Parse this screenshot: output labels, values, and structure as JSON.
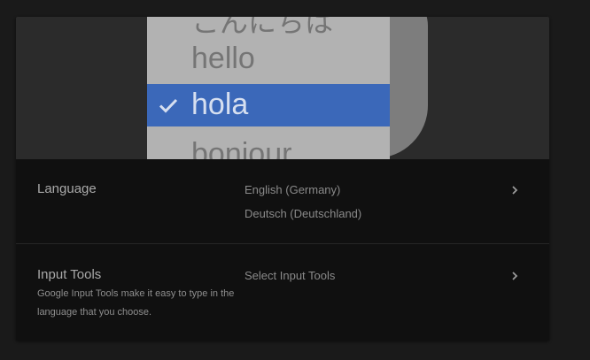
{
  "banner": {
    "items": [
      "こんにちは",
      "hello",
      "hola",
      "bonjour"
    ],
    "selected": "hola"
  },
  "language": {
    "title": "Language",
    "values": [
      "English (Germany)",
      "Deutsch (Deutschland)"
    ]
  },
  "input_tools": {
    "title": "Input Tools",
    "description": "Google Input Tools make it easy to type in the language that you choose.",
    "value": "Select Input Tools"
  },
  "colors": {
    "accent": "#3b68b9",
    "background": "#101010"
  }
}
